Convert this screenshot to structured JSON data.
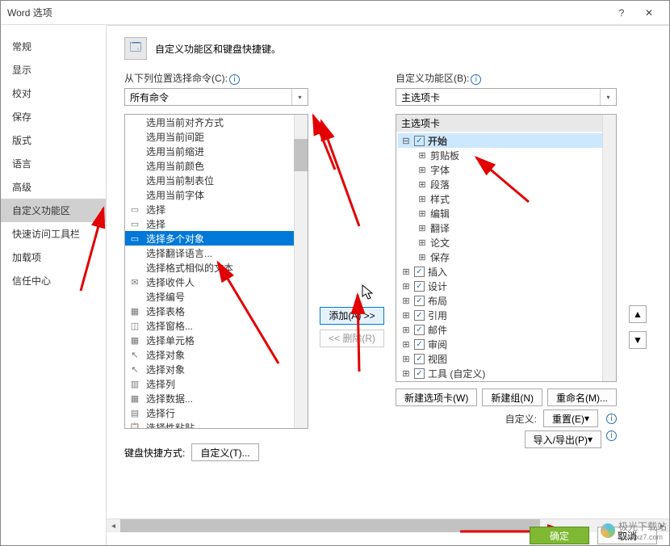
{
  "window": {
    "title": "Word 选项"
  },
  "sidebar": {
    "items": [
      "常规",
      "显示",
      "校对",
      "保存",
      "版式",
      "语言",
      "高级",
      "自定义功能区",
      "快速访问工具栏",
      "加载项",
      "信任中心"
    ],
    "selectedIndex": 7
  },
  "header": {
    "icon": "gear-ribbon-icon",
    "text": "自定义功能区和键盘快捷键。"
  },
  "left": {
    "label": "从下列位置选择命令(C):",
    "dropdown": "所有命令",
    "items": [
      {
        "icon": "",
        "text": "选用当前对齐方式"
      },
      {
        "icon": "",
        "text": "选用当前间距"
      },
      {
        "icon": "",
        "text": "选用当前缩进"
      },
      {
        "icon": "",
        "text": "选用当前颜色"
      },
      {
        "icon": "",
        "text": "选用当前制表位"
      },
      {
        "icon": "",
        "text": "选用当前字体"
      },
      {
        "icon": "▭",
        "text": "选择",
        "sub": "▸"
      },
      {
        "icon": "▭",
        "text": "选择",
        "sub": "▸"
      },
      {
        "icon": "▭",
        "text": "选择多个对象",
        "selected": true
      },
      {
        "icon": "",
        "text": "选择翻译语言..."
      },
      {
        "icon": "",
        "text": "选择格式相似的文本"
      },
      {
        "icon": "✉",
        "text": "选择收件人",
        "sub": "▸"
      },
      {
        "icon": "",
        "text": "选择编号"
      },
      {
        "icon": "▦",
        "text": "选择表格"
      },
      {
        "icon": "◫",
        "text": "选择窗格..."
      },
      {
        "icon": "▦",
        "text": "选择单元格"
      },
      {
        "icon": "↖",
        "text": "选择对象"
      },
      {
        "icon": "↖",
        "text": "选择对象"
      },
      {
        "icon": "▥",
        "text": "选择列"
      },
      {
        "icon": "▦",
        "text": "选择数据..."
      },
      {
        "icon": "▤",
        "text": "选择行"
      },
      {
        "icon": "📋",
        "text": "选择性粘贴..."
      }
    ]
  },
  "mid": {
    "add": "添加(A) >>",
    "remove": "<< 删除(R)"
  },
  "right": {
    "label": "自定义功能区(B):",
    "dropdown": "主选项卡",
    "treeHeader": "主选项卡",
    "nodes": [
      {
        "d": 1,
        "exp": "⊟",
        "cb": true,
        "text": "开始",
        "bold": true,
        "sel": true
      },
      {
        "d": 2,
        "exp": "⊞",
        "text": "剪贴板"
      },
      {
        "d": 2,
        "exp": "⊞",
        "text": "字体"
      },
      {
        "d": 2,
        "exp": "⊞",
        "text": "段落"
      },
      {
        "d": 2,
        "exp": "⊞",
        "text": "样式"
      },
      {
        "d": 2,
        "exp": "⊞",
        "text": "编辑"
      },
      {
        "d": 2,
        "exp": "⊞",
        "text": "翻译"
      },
      {
        "d": 2,
        "exp": "⊞",
        "text": "论文"
      },
      {
        "d": 2,
        "exp": "⊞",
        "text": "保存"
      },
      {
        "d": 1,
        "exp": "⊞",
        "cb": true,
        "text": "插入"
      },
      {
        "d": 1,
        "exp": "⊞",
        "cb": true,
        "text": "设计"
      },
      {
        "d": 1,
        "exp": "⊞",
        "cb": true,
        "text": "布局"
      },
      {
        "d": 1,
        "exp": "⊞",
        "cb": true,
        "text": "引用"
      },
      {
        "d": 1,
        "exp": "⊞",
        "cb": true,
        "text": "邮件"
      },
      {
        "d": 1,
        "exp": "⊞",
        "cb": true,
        "text": "审阅"
      },
      {
        "d": 1,
        "exp": "⊞",
        "cb": true,
        "text": "视图"
      },
      {
        "d": 1,
        "exp": "⊞",
        "cb": true,
        "text": "工具 (自定义)"
      }
    ],
    "buttons": {
      "newTab": "新建选项卡(W)",
      "newGroup": "新建组(N)",
      "rename": "重命名(M)..."
    },
    "customLabel": "自定义:",
    "reset": "重置(E)",
    "importExport": "导入/导出(P)"
  },
  "kb": {
    "label": "键盘快捷方式:",
    "button": "自定义(T)..."
  },
  "footer": {
    "ok": "确定",
    "cancel": "取消"
  },
  "logo": {
    "name": "极光下载站",
    "url": "www.xz7.com"
  }
}
